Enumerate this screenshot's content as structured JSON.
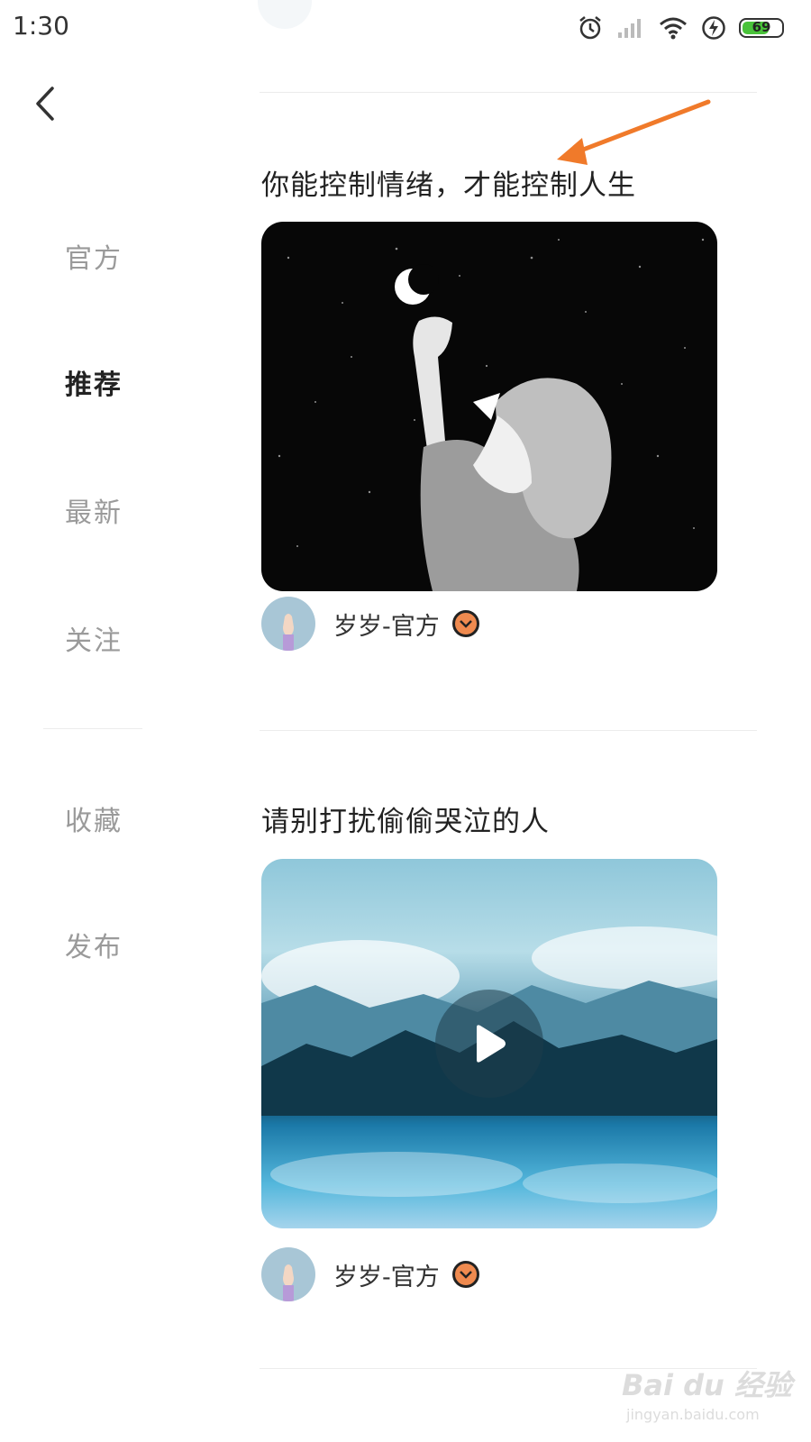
{
  "status_bar": {
    "time": "1:30",
    "battery": "69",
    "icons": [
      "alarm-icon",
      "signal-icon",
      "wifi-icon",
      "charging-icon",
      "battery-icon"
    ]
  },
  "sidebar": {
    "items": [
      {
        "label": "官方",
        "active": false
      },
      {
        "label": "推荐",
        "active": true
      },
      {
        "label": "最新",
        "active": false
      },
      {
        "label": "关注",
        "active": false
      },
      {
        "label": "收藏",
        "active": false
      },
      {
        "label": "发布",
        "active": false
      }
    ]
  },
  "feed": {
    "cards": [
      {
        "title": "你能控制情绪，才能控制人生",
        "image": "girl-reaching-moon-illustration",
        "author": "岁岁-官方",
        "verified": true
      },
      {
        "title": "请别打扰偷偷哭泣的人",
        "image": "mountain-lake-video-thumbnail",
        "has_video": true,
        "author": "岁岁-官方",
        "verified": true
      }
    ]
  },
  "watermark": {
    "brand": "Bai du 经验",
    "url": "jingyan.baidu.com"
  },
  "colors": {
    "accent_arrow": "#f07a2a",
    "badge": "#ef8a4f",
    "active_text": "#222222",
    "inactive_text": "#9a9a9a"
  }
}
